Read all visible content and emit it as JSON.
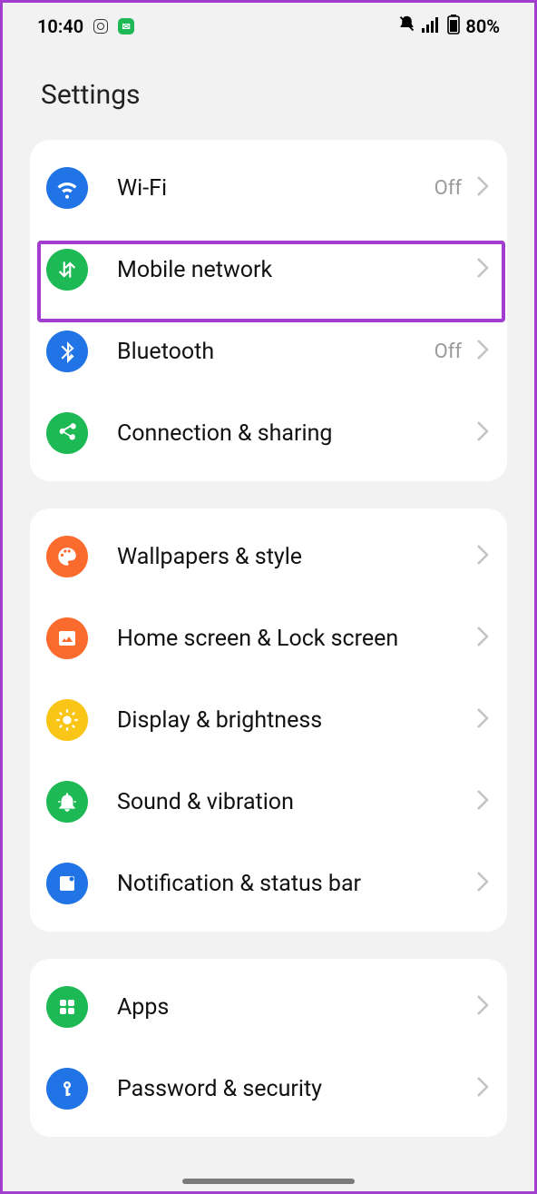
{
  "status_bar": {
    "time": "10:40",
    "battery": "80%"
  },
  "title": "Settings",
  "groups": [
    {
      "items": [
        {
          "id": "wifi",
          "label": "Wi-Fi",
          "value": "Off",
          "icon_color": "#2074e6",
          "icon": "wifi"
        },
        {
          "id": "mobile-network",
          "label": "Mobile network",
          "value": "",
          "icon_color": "#1db954",
          "icon": "mobile-data"
        },
        {
          "id": "bluetooth",
          "label": "Bluetooth",
          "value": "Off",
          "icon_color": "#2074e6",
          "icon": "bluetooth"
        },
        {
          "id": "connection-sharing",
          "label": "Connection & sharing",
          "value": "",
          "icon_color": "#1db954",
          "icon": "share"
        }
      ]
    },
    {
      "items": [
        {
          "id": "wallpapers",
          "label": "Wallpapers & style",
          "value": "",
          "icon_color": "#fb6b2e",
          "icon": "palette"
        },
        {
          "id": "home-lock",
          "label": "Home screen & Lock screen",
          "value": "",
          "icon_color": "#fb6b2e",
          "icon": "picture"
        },
        {
          "id": "display",
          "label": "Display & brightness",
          "value": "",
          "icon_color": "#f9c516",
          "icon": "sun"
        },
        {
          "id": "sound",
          "label": "Sound & vibration",
          "value": "",
          "icon_color": "#1db954",
          "icon": "bell"
        },
        {
          "id": "notification",
          "label": "Notification & status bar",
          "value": "",
          "icon_color": "#2074e6",
          "icon": "notif"
        }
      ]
    },
    {
      "items": [
        {
          "id": "apps",
          "label": "Apps",
          "value": "",
          "icon_color": "#1db954",
          "icon": "grid"
        },
        {
          "id": "password",
          "label": "Password & security",
          "value": "",
          "icon_color": "#2074e6",
          "icon": "key"
        }
      ]
    }
  ]
}
